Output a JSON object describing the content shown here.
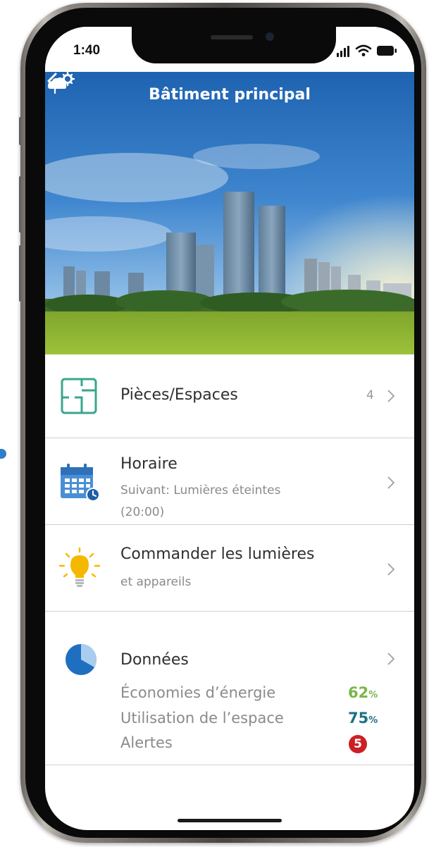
{
  "status_bar": {
    "time": "1:40"
  },
  "header": {
    "title": "Bâtiment principal"
  },
  "menu": {
    "spaces": {
      "label": "Pièces/Espaces",
      "count": "4"
    },
    "schedule": {
      "label": "Horaire",
      "sub1": "Suivant: Lumières éteintes",
      "sub2": "(20:00)"
    },
    "lights": {
      "label": "Commander les lumières",
      "sub": "et appareils"
    },
    "data": {
      "label": "Données",
      "energy_label": "Économies d’énergie",
      "energy_value": "62",
      "space_label": "Utilisation de l’espace",
      "space_value": "75",
      "alerts_label": "Alertes",
      "alerts_count": "5",
      "unit": "%"
    }
  },
  "colors": {
    "accent_teal": "#3aa58e",
    "accent_blue": "#2f7fc8",
    "energy_green": "#7ab648",
    "space_teal": "#1f6f85",
    "alert_red": "#cc1f24",
    "bulb_yellow": "#f5b800"
  },
  "icons": [
    "back-arrow-icon",
    "settings-gear-icon",
    "floor-plan-icon",
    "calendar-clock-icon",
    "light-bulb-icon",
    "pie-chart-icon",
    "chevron-right-icon"
  ]
}
